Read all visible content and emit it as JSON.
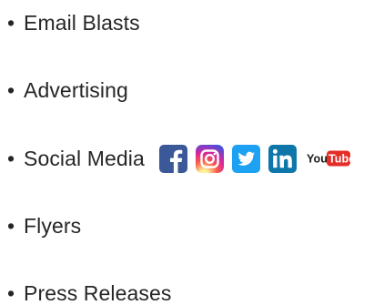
{
  "list": {
    "bullet": "•",
    "items": [
      {
        "label": "Email Blasts"
      },
      {
        "label": "Advertising"
      },
      {
        "label": "Social Media"
      },
      {
        "label": "Flyers"
      },
      {
        "label": "Press Releases"
      }
    ]
  },
  "social_icons": [
    {
      "name": "facebook-icon",
      "color": "#3b5998"
    },
    {
      "name": "instagram-icon",
      "color": "#d6249f"
    },
    {
      "name": "twitter-icon",
      "color": "#1da1f2"
    },
    {
      "name": "linkedin-icon",
      "color": "#0e76a8"
    },
    {
      "name": "youtube-icon",
      "color": "#e52d27",
      "text_you": "You",
      "text_tube": "Tube"
    }
  ]
}
